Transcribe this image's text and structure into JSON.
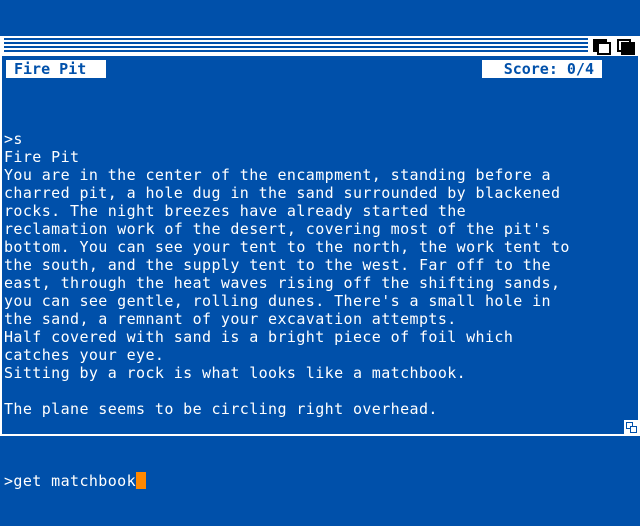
{
  "header": {
    "location": "Fire Pit",
    "score": "Score: 0/4"
  },
  "transcript": [
    ">s",
    "Fire Pit",
    "You are in the center of the encampment, standing before a",
    "charred pit, a hole dug in the sand surrounded by blackened",
    "rocks. The night breezes have already started the",
    "reclamation work of the desert, covering most of the pit's",
    "bottom. You can see your tent to the north, the work tent to",
    "the south, and the supply tent to the west. Far off to the",
    "east, through the heat waves rising off the shifting sands,",
    "you can see gentle, rolling dunes. There's a small hole in",
    "the sand, a remnant of your excavation attempts.",
    "Half covered with sand is a bright piece of foil which",
    "catches your eye.",
    "Sitting by a rock is what looks like a matchbook.",
    "",
    "The plane seems to be circling right overhead.",
    ""
  ],
  "input": {
    "value": ">get matchbook"
  },
  "colors": {
    "background": "#0050aa",
    "text": "#ffffff",
    "cursor": "#ff8800"
  },
  "icons": {
    "depth_back": "depth-back-icon",
    "depth_front": "depth-front-icon",
    "resize": "resize-icon"
  }
}
